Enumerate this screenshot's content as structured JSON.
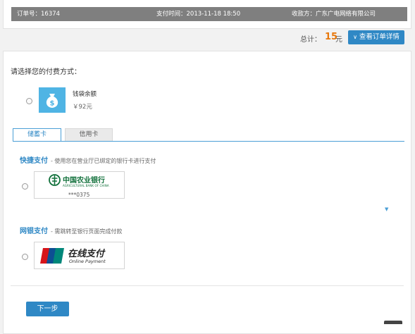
{
  "order_info": {
    "order_no": "订单号：16374",
    "pay_time": "支付时间：2013-11-18 18:50",
    "payee": "收款方：广东广电网络有限公司"
  },
  "summary": {
    "total_label": "总计：",
    "total_amount": "15",
    "total_unit": "元",
    "detail_button": "查看订单详情"
  },
  "payment": {
    "title": "请选择您的付费方式：",
    "wallet": {
      "label": "钱袋余额",
      "amount": "￥92元",
      "icon": "money-bag-icon"
    },
    "tabs": [
      {
        "label": "储蓄卡",
        "active": true
      },
      {
        "label": "信用卡",
        "active": false
      }
    ],
    "quick_pay": {
      "title": "快捷支付",
      "desc": "- 使用您在营业厅已绑定的银行卡进行支付",
      "bank": {
        "name_cn": "中国农业银行",
        "name_en": "AGRICULTURAL BANK OF CHINA",
        "card_no": "***0375"
      }
    },
    "online_pay": {
      "title": "网银支付",
      "desc": "- 需跳转至银行页面完成付款",
      "logo_text": "在线支付",
      "logo_sub": "Online Payment",
      "logo_brand": "UnionPay 银联"
    },
    "next_button": "下一步"
  },
  "colors": {
    "accent": "#2f88c5",
    "total_amount": "#e8780c",
    "info_bar": "#7f7f7f",
    "bank_green": "#10703a"
  }
}
